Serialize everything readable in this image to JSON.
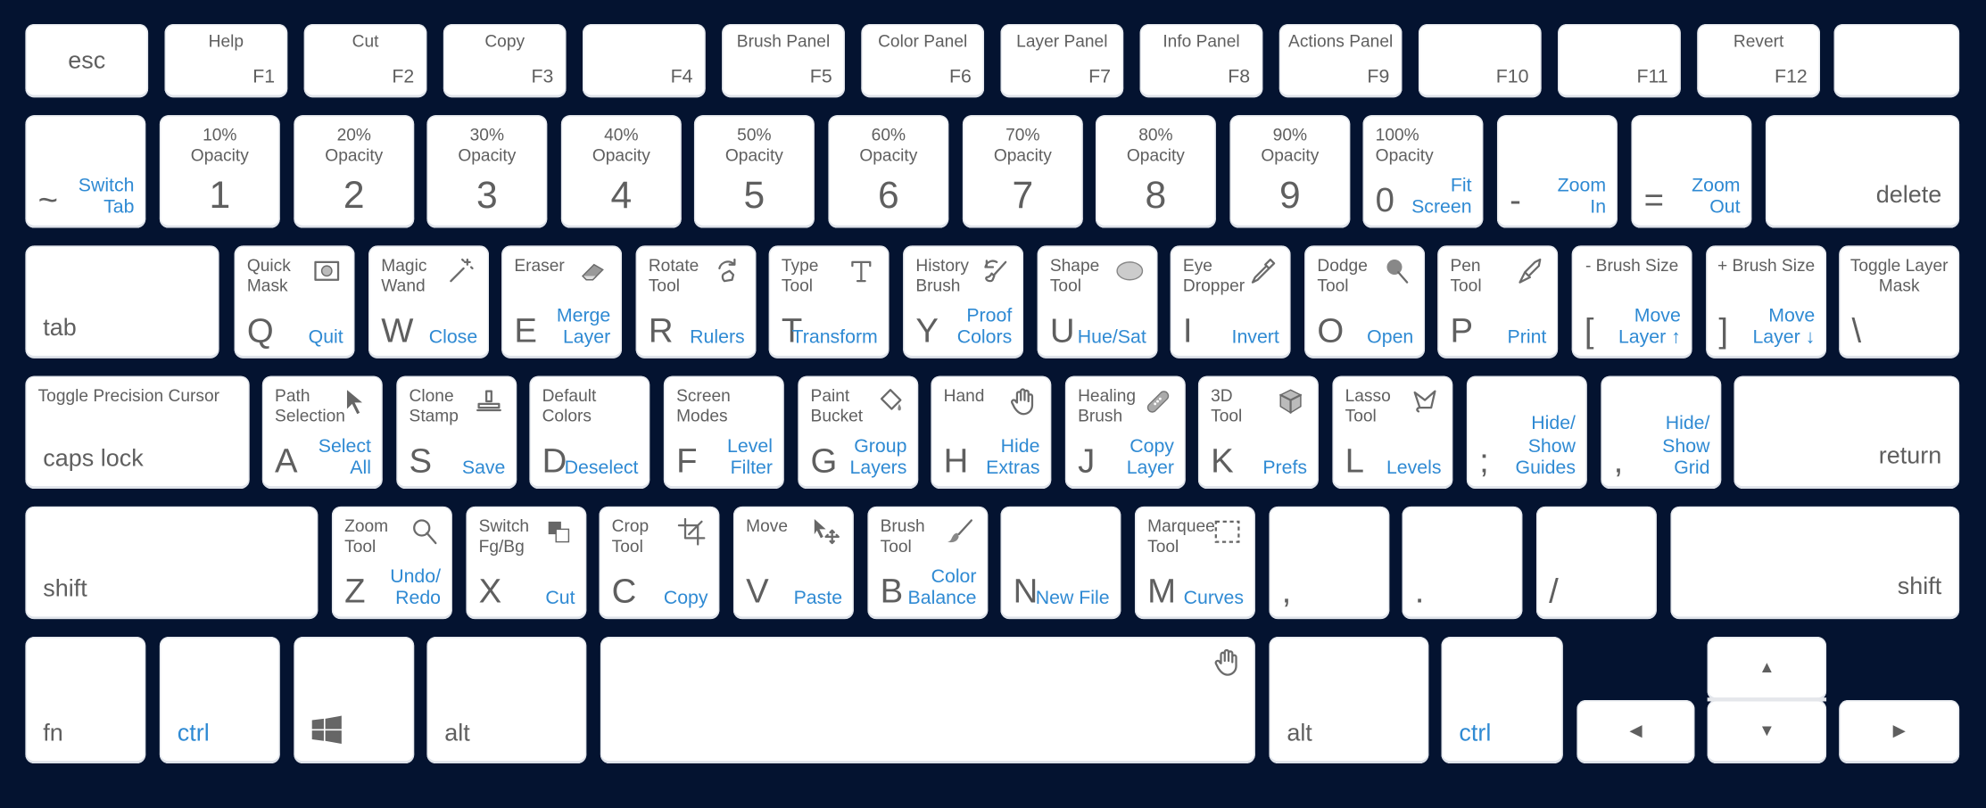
{
  "colors": {
    "background": "#041330",
    "key": "#ffffff",
    "label": "#5f5f5f",
    "action": "#2f8ad3"
  },
  "rows": [
    [
      {
        "main": "esc"
      },
      {
        "top": "Help",
        "main": "F1"
      },
      {
        "top": "Cut",
        "main": "F2"
      },
      {
        "top": "Copy",
        "main": "F3"
      },
      {
        "top": "",
        "main": "F4"
      },
      {
        "top": "Brush Panel",
        "main": "F5"
      },
      {
        "top": "Color Panel",
        "main": "F6"
      },
      {
        "top": "Layer Panel",
        "main": "F7"
      },
      {
        "top": "Info Panel",
        "main": "F8"
      },
      {
        "top": "Actions Panel",
        "main": "F9"
      },
      {
        "top": "",
        "main": "F10"
      },
      {
        "top": "",
        "main": "F11"
      },
      {
        "top": "Revert",
        "main": "F12"
      },
      {
        "main": ""
      }
    ],
    [
      {
        "main": "~",
        "action": "Switch\nTab"
      },
      {
        "top": "10%\nOpacity",
        "main": "1"
      },
      {
        "top": "20%\nOpacity",
        "main": "2"
      },
      {
        "top": "30%\nOpacity",
        "main": "3"
      },
      {
        "top": "40%\nOpacity",
        "main": "4"
      },
      {
        "top": "50%\nOpacity",
        "main": "5"
      },
      {
        "top": "60%\nOpacity",
        "main": "6"
      },
      {
        "top": "70%\nOpacity",
        "main": "7"
      },
      {
        "top": "80%\nOpacity",
        "main": "8"
      },
      {
        "top": "90%\nOpacity",
        "main": "9"
      },
      {
        "top": "100%\nOpacity",
        "main": "0",
        "action": "Fit\nScreen"
      },
      {
        "main": "-",
        "action": "Zoom\nIn"
      },
      {
        "main": "=",
        "action": "Zoom\nOut"
      },
      {
        "main": "delete"
      }
    ],
    [
      {
        "main": "tab"
      },
      {
        "top": "Quick\nMask",
        "main": "Q",
        "action": "Quit",
        "icon": "quick-mask"
      },
      {
        "top": "Magic\nWand",
        "main": "W",
        "action": "Close",
        "icon": "magic-wand"
      },
      {
        "top": "Eraser",
        "main": "E",
        "action": "Merge\nLayer",
        "icon": "eraser"
      },
      {
        "top": "Rotate\nTool",
        "main": "R",
        "action": "Rulers",
        "icon": "rotate"
      },
      {
        "top": "Type\nTool",
        "main": "T",
        "action": "Transform",
        "icon": "type"
      },
      {
        "top": "History\nBrush",
        "main": "Y",
        "action": "Proof\nColors",
        "icon": "history-brush"
      },
      {
        "top": "Shape\nTool",
        "main": "U",
        "action": "Hue/Sat",
        "icon": "shape"
      },
      {
        "top": "Eye\nDropper",
        "main": "I",
        "action": "Invert",
        "icon": "eyedropper"
      },
      {
        "top": "Dodge\nTool",
        "main": "O",
        "action": "Open",
        "icon": "dodge"
      },
      {
        "top": "Pen\nTool",
        "main": "P",
        "action": "Print",
        "icon": "pen"
      },
      {
        "top": "- Brush Size",
        "main": "[",
        "action": "Move\nLayer ↑"
      },
      {
        "top": "+ Brush Size",
        "main": "]",
        "action": "Move\nLayer ↓"
      },
      {
        "top": "Toggle Layer\nMask",
        "main": "\\"
      }
    ],
    [
      {
        "top": "Toggle Precision Cursor",
        "main": "caps lock"
      },
      {
        "top": "Path\nSelection",
        "main": "A",
        "action": "Select\nAll",
        "icon": "path-selection"
      },
      {
        "top": "Clone\nStamp",
        "main": "S",
        "action": "Save",
        "icon": "clone-stamp"
      },
      {
        "top": "Default Colors",
        "main": "D",
        "action": "Deselect"
      },
      {
        "top": "Screen Modes",
        "main": "F",
        "action": "Level\nFilter"
      },
      {
        "top": "Paint\nBucket",
        "main": "G",
        "action": "Group\nLayers",
        "icon": "paint-bucket"
      },
      {
        "top": "Hand",
        "main": "H",
        "action": "Hide\nExtras",
        "icon": "hand"
      },
      {
        "top": "Healing\nBrush",
        "main": "J",
        "action": "Copy\nLayer",
        "icon": "bandage"
      },
      {
        "top": "3D\nTool",
        "main": "K",
        "action": "Prefs",
        "icon": "cube"
      },
      {
        "top": "Lasso\nTool",
        "main": "L",
        "action": "Levels",
        "icon": "lasso"
      },
      {
        "main": ";",
        "action": "Hide/\nShow\nGuides"
      },
      {
        "main": ",",
        "action": "Hide/\nShow\nGrid"
      },
      {
        "main": "return"
      }
    ],
    [
      {
        "main": "shift"
      },
      {
        "top": "Zoom\nTool",
        "main": "Z",
        "action": "Undo/\nRedo",
        "icon": "zoom"
      },
      {
        "top": "Switch\nFg/Bg",
        "main": "X",
        "action": "Cut",
        "icon": "switch-colors"
      },
      {
        "top": "Crop\nTool",
        "main": "C",
        "action": "Copy",
        "icon": "crop"
      },
      {
        "top": "Move",
        "main": "V",
        "action": "Paste",
        "icon": "move"
      },
      {
        "top": "Brush\nTool",
        "main": "B",
        "action": "Color\nBalance",
        "icon": "brush"
      },
      {
        "main": "N",
        "action": "New File"
      },
      {
        "top": "Marquee\nTool",
        "main": "M",
        "action": "Curves",
        "icon": "marquee"
      },
      {
        "main": ","
      },
      {
        "main": "."
      },
      {
        "main": "/"
      },
      {
        "main": "shift"
      }
    ],
    [
      {
        "main": "fn"
      },
      {
        "main": "ctrl"
      },
      {
        "icon": "windows"
      },
      {
        "main": "alt"
      },
      {
        "icon": "hand"
      },
      {
        "main": "alt"
      },
      {
        "main": "ctrl"
      },
      {
        "main": "◀"
      },
      {
        "main": "▲"
      },
      {
        "main": "▼"
      },
      {
        "main": "▶"
      }
    ]
  ]
}
